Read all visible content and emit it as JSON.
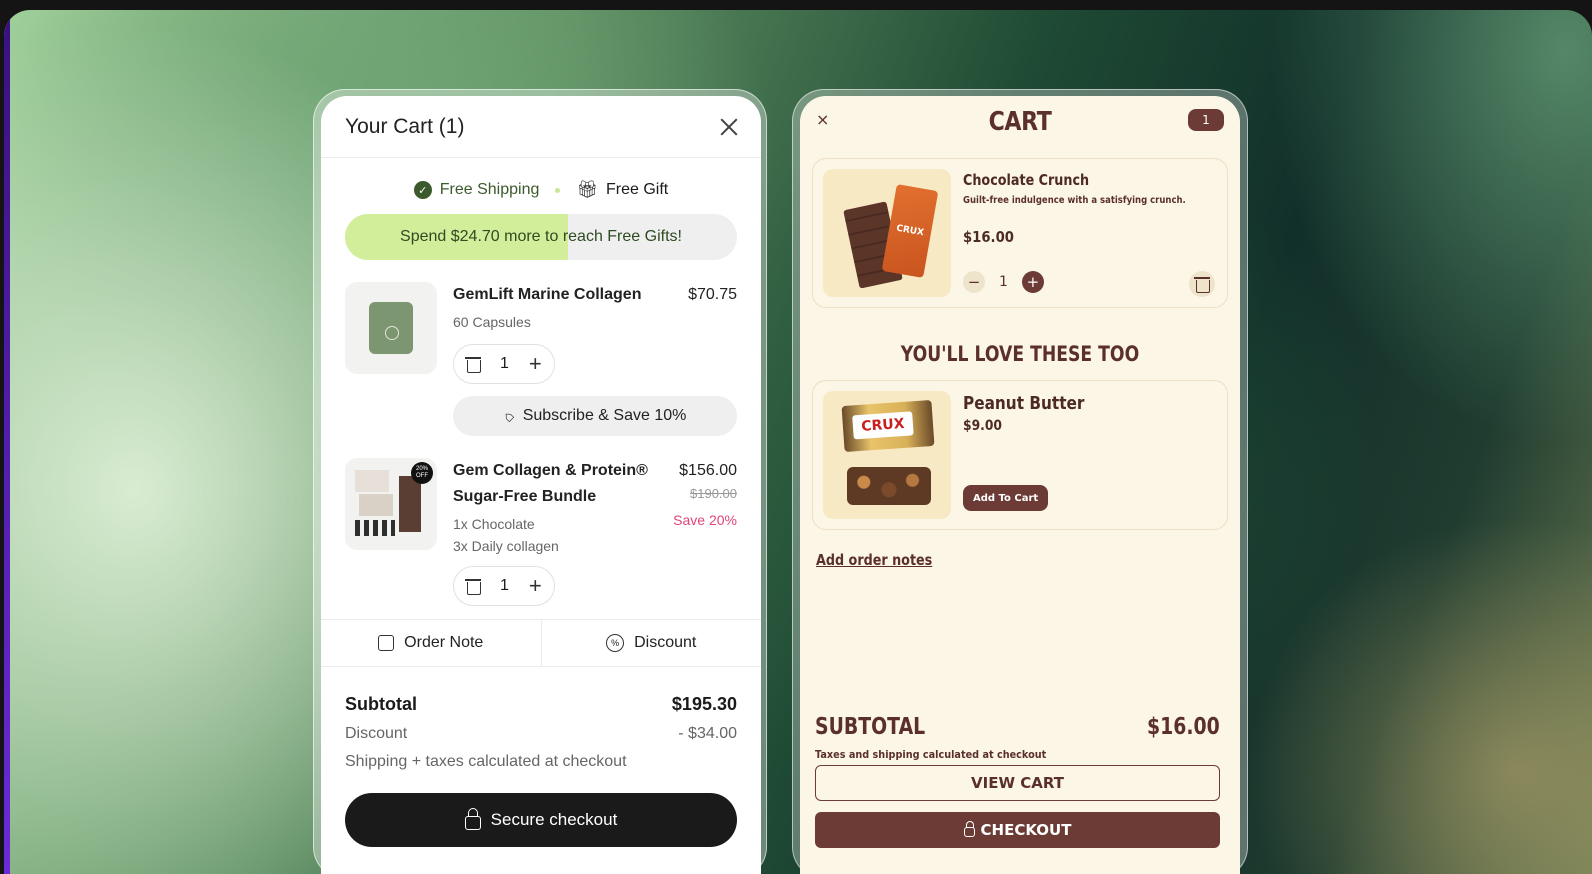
{
  "left_cart": {
    "title": "Your Cart (1)",
    "perks": [
      {
        "label": "Free Shipping",
        "icon": "check-circle-icon"
      },
      {
        "label": "Free Gift",
        "icon": "gift-icon"
      }
    ],
    "progress": {
      "prefix": "Spend $24.70 more to reach ",
      "highlight": "Free Gifts!",
      "fill_fraction": 0.57
    },
    "items": [
      {
        "name": "GemLift Marine Collagen",
        "price": "$70.75",
        "variants": [
          "60 Capsules"
        ],
        "quantity": "1",
        "subscribe_label": "Subscribe & Save 10%"
      },
      {
        "name": "Gem Collagen & Protein® Sugar-Free Bundle",
        "price": "$156.00",
        "compare_price": "$190.00",
        "save_label": "Save 20%",
        "badge": "20% OFF",
        "variants": [
          "1x Chocolate",
          "3x Daily collagen"
        ],
        "quantity": "1"
      }
    ],
    "actions": {
      "order_note": "Order Note",
      "discount": "Discount"
    },
    "totals": {
      "subtotal_label": "Subtotal",
      "subtotal": "$195.30",
      "discount_label": "Discount",
      "discount": "- $34.00",
      "shipping_note": "Shipping + taxes calculated at checkout"
    },
    "checkout_label": "Secure checkout"
  },
  "right_cart": {
    "close_icon": "×",
    "title": "CART",
    "count": "1",
    "item": {
      "name": "Chocolate Crunch",
      "description": "Guilt-free indulgence with a satisfying crunch.",
      "price": "$16.00",
      "quantity": "1",
      "image_text": "CRUX"
    },
    "upsell_title": "YOU'LL LOVE THESE TOO",
    "upsell": {
      "name": "Peanut Butter",
      "price": "$9.00",
      "add_label": "Add To Cart",
      "image_text": "CRUX"
    },
    "notes_label": "Add order notes",
    "subtotal_label": "SUBTOTAL",
    "subtotal": "$16.00",
    "tax_note": "Taxes and shipping calculated at checkout",
    "view_cart_label": "VIEW CART",
    "checkout_label": "CHECKOUT"
  },
  "colors": {
    "left_accent": "#d3ee9a",
    "left_checkout_bg": "#1a1a1a",
    "right_bg": "#fcf6e6",
    "right_accent": "#6c3b36",
    "sale_pink": "#e0457b"
  }
}
